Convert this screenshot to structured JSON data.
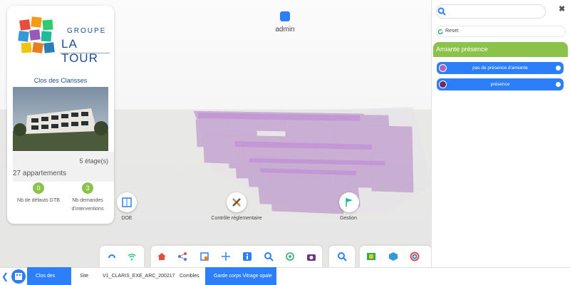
{
  "user": {
    "name": "admin",
    "icon": "user-icon"
  },
  "card": {
    "logo_top": "GROUPE",
    "logo_bottom": "LA TOUR",
    "project_name": "Clos des Clarisses",
    "floors": "5 étage(s)",
    "apartments": "27 appartements",
    "kpis": [
      {
        "value": "0",
        "label": "Nb de défauts GTB"
      },
      {
        "value": "3",
        "label": "Nb demandes d'interventions"
      }
    ]
  },
  "floating": {
    "doe": "DOE",
    "controle": "Contrôle réglementaire",
    "gestion": "Gestion"
  },
  "breadcrumb": [
    "Clos des clarisses",
    "Site",
    "V1_CLARIS_EXE_ARC_200217",
    "Combles",
    "Garde corps Vitrage opale"
  ],
  "panel": {
    "search_placeholder": "",
    "reset_label": "Reset",
    "section_title": "Amiante présence",
    "legend": [
      {
        "label": "pas de présence d'amiante",
        "color": "#b45fc7"
      },
      {
        "label": "présence",
        "color": "#6a2a6e"
      }
    ]
  },
  "colors": {
    "accent": "#2d7ff9",
    "green": "#8bc34a",
    "building": "#9b59b6"
  }
}
